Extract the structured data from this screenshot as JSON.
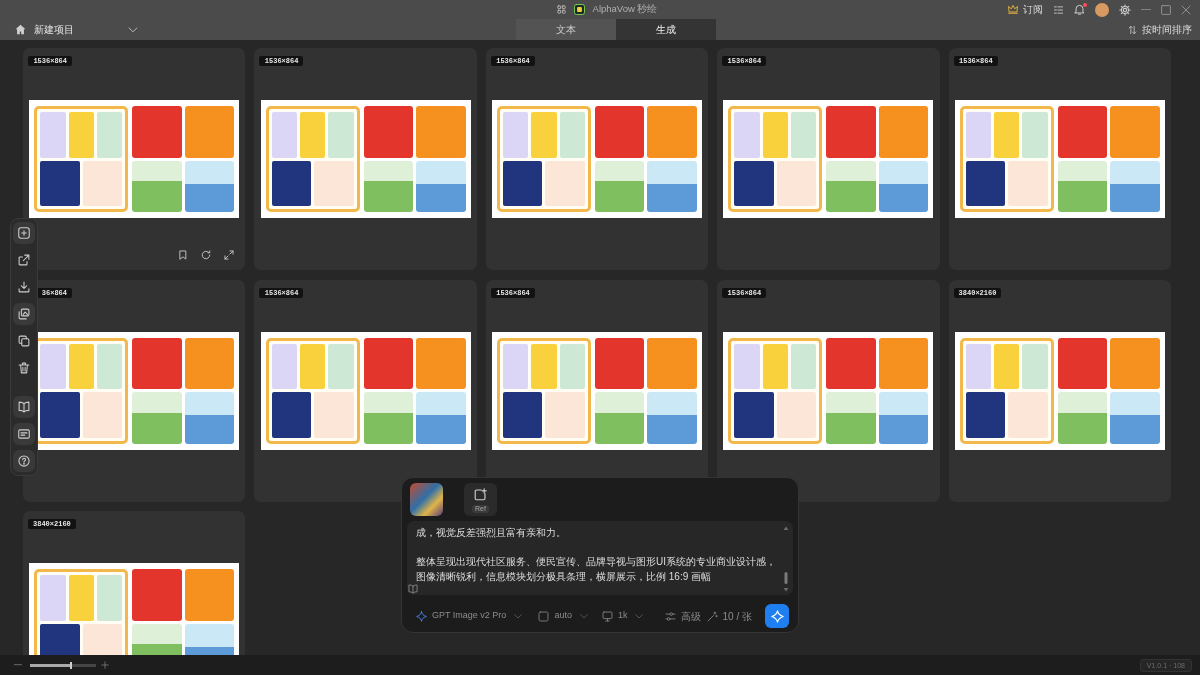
{
  "window": {
    "title": "AlphaVow 秒绘"
  },
  "title_bar": {
    "subscribe": "订阅",
    "notifications_unread": true
  },
  "project_bar": {
    "project_name": "新建项目",
    "tabs": [
      {
        "label": "文本",
        "selected": false
      },
      {
        "label": "生成",
        "selected": true
      }
    ],
    "sort": "按时间排序"
  },
  "left_toolbar": {
    "groups": [
      {
        "items": [
          {
            "disabled": false
          },
          {
            "disabled": true
          },
          {
            "disabled": true
          },
          {
            "disabled": false
          },
          {
            "disabled": true
          },
          {
            "disabled": true
          }
        ]
      },
      {
        "items": [
          {
            "disabled": false
          },
          {
            "disabled": false
          },
          {
            "disabled": false
          }
        ]
      }
    ]
  },
  "results": [
    {
      "size": "1536×864",
      "hovered": true
    },
    {
      "size": "1536×864"
    },
    {
      "size": "1536×864"
    },
    {
      "size": "1536×864"
    },
    {
      "size": "1536×864"
    },
    {
      "size": "36×864"
    },
    {
      "size": "1536×864"
    },
    {
      "size": "1536×864"
    },
    {
      "size": "1536×864"
    },
    {
      "size": "3840×2160"
    },
    {
      "size": "3840×2160"
    }
  ],
  "prompt_panel": {
    "reference_label": "Ref",
    "prompt_paragraphs": [
      "成，视觉反差强烈且富有亲和力。",
      "整体呈现出现代社区服务、便民宣传、品牌导视与图形UI系统的专业商业设计感，图像清晰锐利，信息模块划分极具条理，横屏展示，比例 16:9 画幅"
    ],
    "model": "GPT Image v2 Pro",
    "aspect_ratio": "auto",
    "resolution": "1k",
    "advanced": "高级",
    "quantity": "10 / 张"
  },
  "status_bar": {
    "zoom": {
      "level": 0.62
    },
    "version": "V1.0.1 · 108"
  }
}
